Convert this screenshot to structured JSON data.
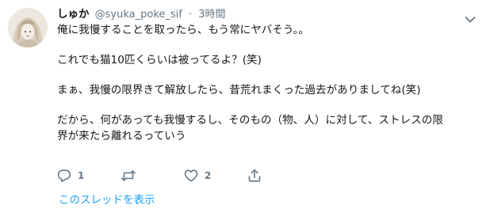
{
  "tweet": {
    "display_name": "しゅか",
    "handle": "@syuka_poke_sif",
    "separator": "·",
    "time": "3時間",
    "body": {
      "line1": "俺に我慢することを取ったら、もう常にヤバそう。。",
      "line2": "これでも猫10匹くらいは被ってるよ？(笑)",
      "line3": "まぁ、我慢の限界きて解放したら、昔荒れまくった過去がありましてね(笑)",
      "line4": "だから、何があっても我慢するし、そのもの（物、人）に対して、ストレスの限",
      "line5": "界が来たら離れるっていう"
    },
    "actions": {
      "reply_count": "1",
      "retweet_count": "",
      "like_count": "2"
    },
    "show_thread": "このスレッドを表示"
  },
  "icons": {
    "avatar": "avatar-image",
    "caret": "chevron-down-icon",
    "reply": "reply-icon",
    "retweet": "retweet-icon",
    "like": "heart-icon",
    "share": "share-icon"
  },
  "colors": {
    "link": "#1da1f2",
    "secondary_text": "#657786",
    "primary_text": "#14171a",
    "icon": "#657786"
  }
}
